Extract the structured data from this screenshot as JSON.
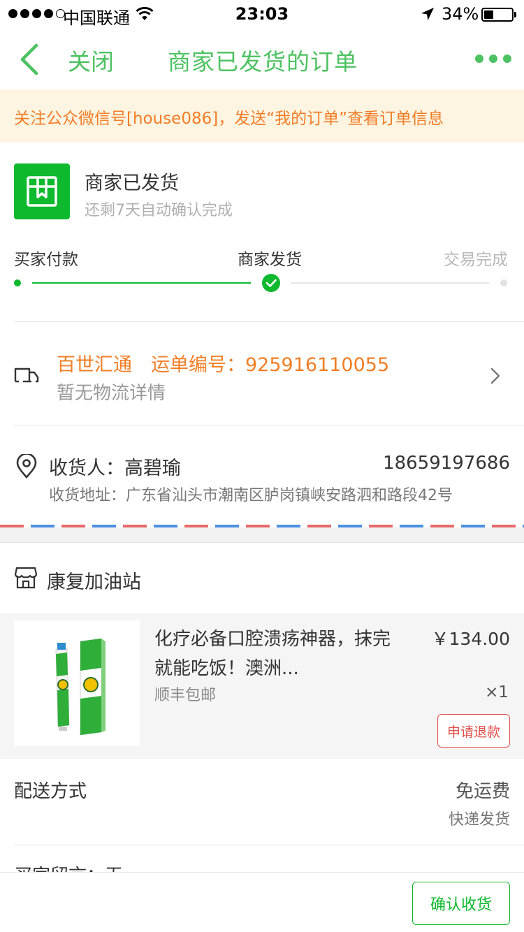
{
  "status_bar": {
    "carrier": "中国联通",
    "time": "23:03",
    "battery_percent": "34%",
    "battery_level": 0.34,
    "signal_bars_filled": 4,
    "signal_bars_total": 5
  },
  "nav": {
    "close_label": "关闭",
    "title": "商家已发货的订单"
  },
  "notice": {
    "text": "关注公众微信号[house086]，发送“我的订单”查看订单信息"
  },
  "order_status": {
    "title": "商家已发货",
    "subtitle": "还剩7天自动确认完成",
    "icon": "package-icon",
    "steps": [
      "买家付款",
      "商家发货",
      "交易完成"
    ],
    "current_step": 2
  },
  "logistics": {
    "company": "百世汇通",
    "tracking_label": "运单编号：925916110055",
    "detail": "暂无物流详情",
    "icon": "truck-icon"
  },
  "address": {
    "recipient": "收货人：高碧瑜",
    "phone": "18659197686",
    "address": "收货地址：广东省汕头市潮南区胪岗镇峡安路泗和路段42号"
  },
  "shop": {
    "name": "康复加油站",
    "icon": "store-icon"
  },
  "product": {
    "title": "化疗必备口腔溃疡神器，抹完就能吃饭！澳洲...",
    "shipping": "顺丰包邮",
    "price": "￥134.00",
    "quantity": "×1",
    "refund_label": "申请退款"
  },
  "delivery": {
    "label": "配送方式",
    "fee": "免运费",
    "method": "快递发货"
  },
  "buyer_message": {
    "text": "买家留言：无"
  },
  "bottom": {
    "confirm_label": "确认收货"
  },
  "colors": {
    "accent_green": "#0eb92e",
    "nav_green": "#4dc262",
    "orange": "#f07e25",
    "refund_red": "#e0504a",
    "notice_bg": "#fdf4e2"
  }
}
